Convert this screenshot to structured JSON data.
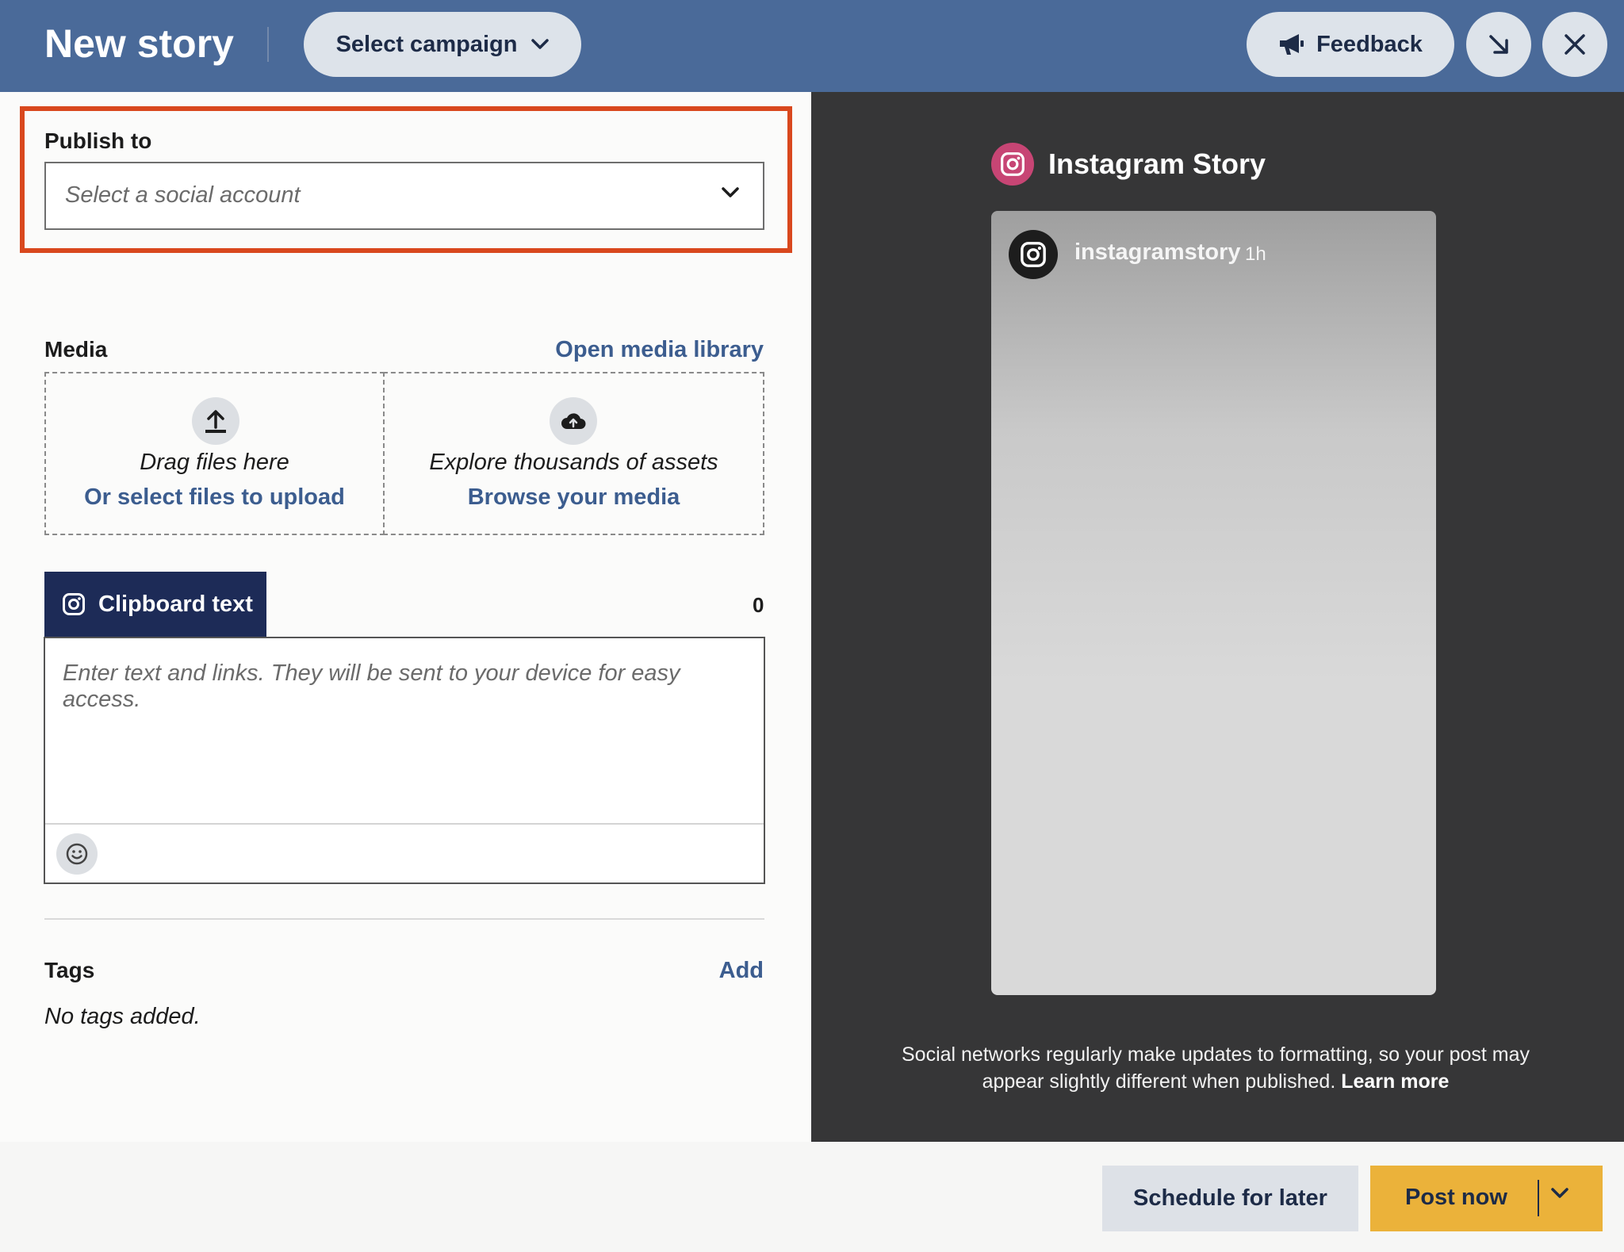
{
  "header": {
    "title": "New story",
    "campaign_label": "Select campaign",
    "feedback_label": "Feedback"
  },
  "publish": {
    "label": "Publish to",
    "placeholder": "Select a social account"
  },
  "media": {
    "label": "Media",
    "library_link": "Open media library",
    "upload_text": "Drag files here",
    "upload_link": "Or select files to upload",
    "assets_text": "Explore thousands of assets",
    "assets_link": "Browse your media"
  },
  "clipboard": {
    "tab_label": "Clipboard text",
    "count": "0",
    "placeholder": "Enter text and links. They will be sent to your device for easy access."
  },
  "tags": {
    "label": "Tags",
    "add_link": "Add",
    "empty_text": "No tags added."
  },
  "preview": {
    "title": "Instagram Story",
    "username": "instagramstory",
    "time": "1h",
    "disclaimer": "Social networks regularly make updates to formatting, so your post may appear slightly different when published.",
    "learn_more": "Learn more"
  },
  "footer": {
    "schedule_label": "Schedule for later",
    "post_label": "Post now"
  },
  "colors": {
    "header_bg": "#4a6a99",
    "highlight": "#d9481e",
    "link": "#3c5d8f",
    "tab_bg": "#1d2b57",
    "instagram": "#c74574",
    "post_button": "#ebb23a"
  }
}
